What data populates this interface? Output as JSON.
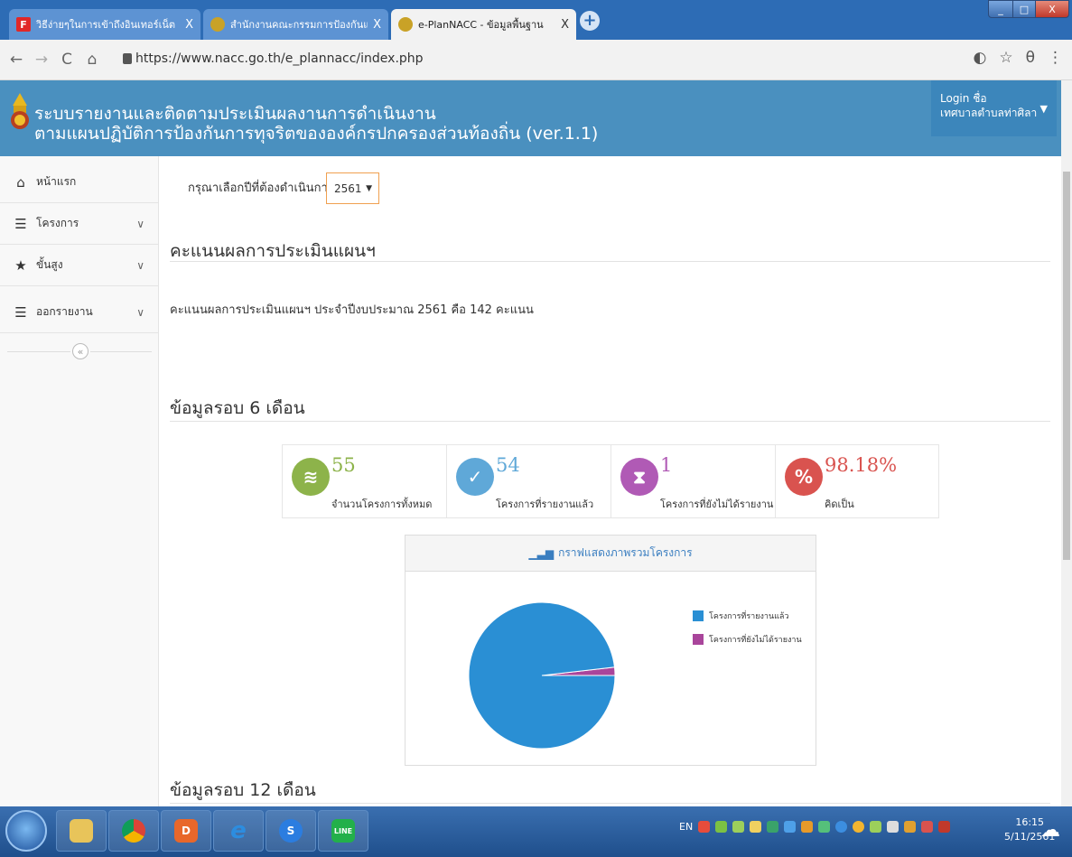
{
  "browser": {
    "tabs": [
      {
        "label": "วิธีง่ายๆในการเข้าถึงอินเทอร์เน็ต",
        "icon": "flipboard-icon",
        "active": false
      },
      {
        "label": "สำนักงานคณะกรรมการป้องกันและปราบปราม",
        "icon": "nacc-emblem-icon",
        "active": false
      },
      {
        "label": "e-PlanNACC - ข้อมูลพื้นฐาน",
        "icon": "nacc-emblem-icon",
        "active": true
      }
    ],
    "close_glyph": "X",
    "new_tab_glyph": "+",
    "url": "https://www.nacc.go.th/e_plannacc/index.php",
    "nav": {
      "back": "←",
      "forward": "→",
      "reload": "C",
      "home": "⌂"
    },
    "window_controls": {
      "minimize": "_",
      "maximize": "□",
      "close": "X"
    }
  },
  "header": {
    "title_line1": "ระบบรายงานและติดตามประเมินผลงานการดำเนินงาน",
    "title_line2": "ตามแผนปฏิบัติการป้องกันการทุจริตขององค์กรปกครองส่วนท้องถิ่น (ver.1.1)",
    "login_label": "Login ชื่อ",
    "login_user": "เทศบาลตำบลท่าศิลา",
    "bg_color": "#4a90bf"
  },
  "sidebar": {
    "items": [
      {
        "label": "หน้าแรก",
        "icon": "home-icon",
        "has_submenu": false
      },
      {
        "label": "โครงการ",
        "icon": "list-icon",
        "has_submenu": true
      },
      {
        "label": "ขั้นสูง",
        "icon": "star-icon",
        "has_submenu": true
      },
      {
        "label": "ออกรายงาน",
        "icon": "list-icon",
        "has_submenu": true
      }
    ],
    "collapse_glyph": "«"
  },
  "main": {
    "year_label": "กรุณาเลือกปีที่ต้องดำเนินการ",
    "year_selected": "2561",
    "score_heading": "คะแนนผลการประเมินแผนฯ",
    "score_text": "คะแนนผลการประเมินแผนฯ ประจำปีงบประมาณ 2561 คือ 142 คะแนน",
    "six_month_heading": "ข้อมูลรอบ 6 เดือน",
    "twelve_month_heading": "ข้อมูลรอบ 12 เดือน",
    "stats": [
      {
        "value": "55",
        "label": "จำนวนโครงการทั้งหมด",
        "icon": "database-icon",
        "color": "#8db34a"
      },
      {
        "value": "54",
        "label": "โครงการที่รายงานแล้ว",
        "icon": "check-circle-icon",
        "color": "#5fa8d8"
      },
      {
        "value": "1",
        "label": "โครงการที่ยังไม่ได้รายงาน",
        "icon": "hourglass-icon",
        "color": "#b05ab5"
      },
      {
        "value": "98.18%",
        "label": "คิดเป็น",
        "icon": "percent-icon",
        "color": "#d9534f"
      }
    ],
    "chart_title": "กราฟแสดงภาพรวมโครงการ"
  },
  "chart_data": {
    "type": "pie",
    "title": "กราฟแสดงภาพรวมโครงการ",
    "series": [
      {
        "name": "โครงการที่รายงานแล้ว",
        "value": 54,
        "color": "#2a8fd4"
      },
      {
        "name": "โครงการที่ยังไม่ได้รายงาน",
        "value": 1,
        "color": "#a9459b"
      }
    ],
    "legend_position": "right"
  },
  "taskbar": {
    "lang": "EN",
    "time": "16:15",
    "date": "5/11/2561"
  }
}
